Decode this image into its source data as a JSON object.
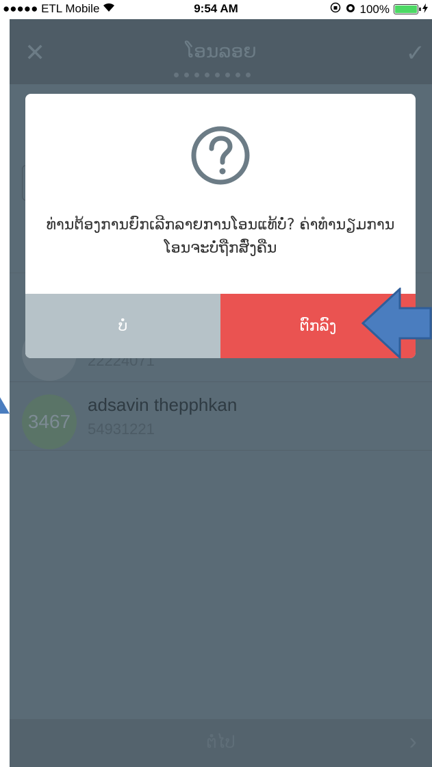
{
  "status_bar": {
    "carrier": "●●●●● ETL Mobile",
    "time": "9:54 AM",
    "battery": "100%",
    "battery_level": 1.0,
    "battery_color": "#4cd964"
  },
  "nav": {
    "title": "ໂອນລອຍ",
    "close_icon": "close-icon",
    "check_icon": "check-icon"
  },
  "contacts": [
    {
      "initials": "",
      "name": "",
      "number": "22224071"
    },
    {
      "initials": "3467",
      "name": "adsavin thepphkan",
      "number": "54931221"
    }
  ],
  "footer": {
    "label": "ຕໍ່ໄປ",
    "arrow_icon": "chevron-right-icon"
  },
  "dialog": {
    "icon": "question-circle-icon",
    "message": "ທ່ານຕ້ອງການຍົກເລີກລາຍການໂອນແທ້ບໍ່? ຄ່າທຳນຽມການໂອນຈະບໍ່ຖືກສົ່ງຄືນ",
    "cancel_label": "ບໍ່",
    "confirm_label": "ຕົກລົງ",
    "cancel_color": "#b6c2c8",
    "confirm_color": "#ea5351"
  },
  "annotations": {
    "arrow_color": "#4a7dbf"
  }
}
